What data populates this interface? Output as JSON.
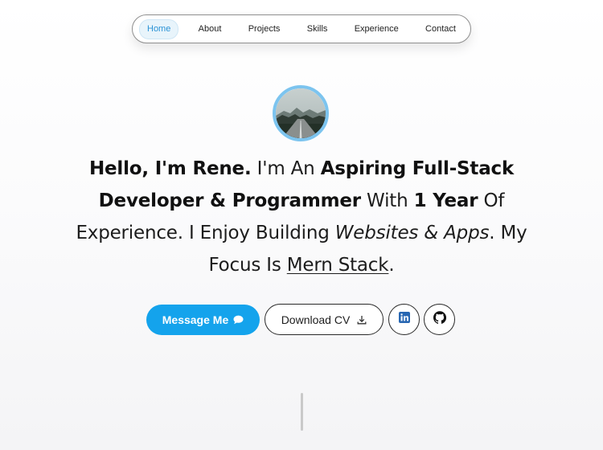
{
  "nav": {
    "items": [
      {
        "label": "Home",
        "active": true
      },
      {
        "label": "About"
      },
      {
        "label": "Projects"
      },
      {
        "label": "Skills"
      },
      {
        "label": "Experience"
      },
      {
        "label": "Contact"
      }
    ]
  },
  "hero": {
    "avatar_icon": "profile-photo-road-landscape",
    "headline": {
      "greeting": "Hello, I'm Rene.",
      "t1": "I'm An",
      "role": "Aspiring Full-Stack Developer & Programmer",
      "t2": "With",
      "years": "1 Year",
      "t3": "Of Experience. I Enjoy Building",
      "build": "Websites & Apps",
      "t4": ". My Focus Is",
      "focus": "Mern Stack",
      "t5": "."
    }
  },
  "actions": {
    "message_label": "Message Me",
    "message_icon": "chat-bubble-icon",
    "download_label": "Download CV",
    "download_icon": "download-icon",
    "linkedin_icon": "linkedin-icon",
    "github_icon": "github-icon"
  },
  "colors": {
    "accent": "#14a3ec",
    "nav_active_text": "#2b93d6",
    "avatar_ring": "#7cc4ef",
    "linkedin": "#2867b2"
  }
}
